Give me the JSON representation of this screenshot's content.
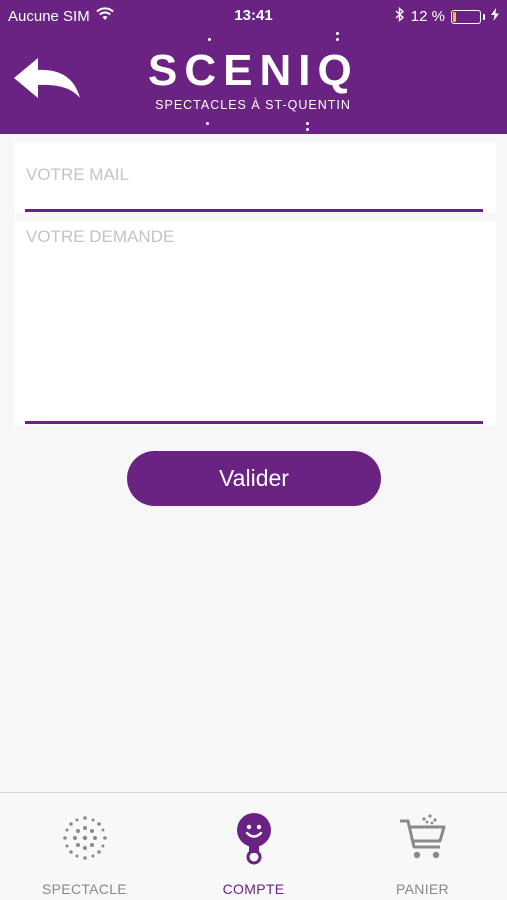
{
  "status_bar": {
    "carrier": "Aucune SIM",
    "time": "13:41",
    "battery_percent": "12 %",
    "battery_level": 0.12
  },
  "header": {
    "logo_word": "SCENIQ",
    "logo_tagline": "SPECTACLES À ST-QUENTIN",
    "back_icon": "back-arrow-icon"
  },
  "form": {
    "mail_placeholder": "VOTRE MAIL",
    "mail_value": "",
    "demande_placeholder": "VOTRE DEMANDE",
    "demande_value": "",
    "submit_label": "Valider"
  },
  "tabs": [
    {
      "label": "SPECTACLE",
      "icon": "sparkle-dots-icon",
      "active": false
    },
    {
      "label": "COMPTE",
      "icon": "account-face-icon",
      "active": true
    },
    {
      "label": "PANIER",
      "icon": "cart-icon",
      "active": false
    }
  ],
  "colors": {
    "brand": "#6a2383",
    "battery": "#f5c518",
    "inactive_tab": "#888888"
  }
}
